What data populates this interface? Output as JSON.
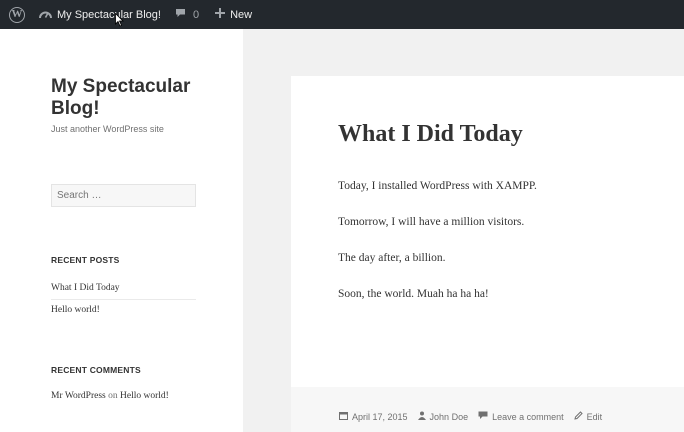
{
  "admin_bar": {
    "wp_logo_icon": "wordpress-logo-icon",
    "site_icon": "dashboard-icon",
    "site_name": "My Spectacular Blog!",
    "comments_icon": "comment-bubble-icon",
    "comments_count": "0",
    "new_icon": "plus-icon",
    "new_label": "New"
  },
  "site": {
    "title": "My Spectacular Blog!",
    "description": "Just another WordPress site"
  },
  "search": {
    "placeholder": "Search …"
  },
  "recent_posts": {
    "title": "RECENT POSTS",
    "items": [
      "What I Did Today",
      "Hello world!"
    ]
  },
  "recent_comments": {
    "title": "RECENT COMMENTS",
    "items": [
      {
        "author": "Mr WordPress",
        "on": "on",
        "post": "Hello world!"
      }
    ]
  },
  "post": {
    "title": "What I Did Today",
    "paragraphs": [
      "Today, I installed WordPress with XAMPP.",
      "Tomorrow, I will have a million visitors.",
      "The day after, a billion.",
      "Soon, the world. Muah ha ha ha!"
    ],
    "meta": {
      "date": "April 17, 2015",
      "author": "John Doe",
      "comment_link": "Leave a comment",
      "edit_link": "Edit"
    }
  },
  "colors": {
    "admin_bar_bg": "#23282d",
    "page_bg": "#f1f1f1",
    "panel_bg": "#ffffff",
    "text": "#333333",
    "muted": "#707070"
  }
}
